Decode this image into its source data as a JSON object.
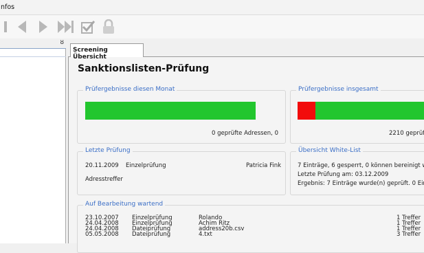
{
  "menu": {
    "label": "nfos"
  },
  "toolbar": {
    "icons": [
      "first-icon",
      "previous-icon",
      "next-icon",
      "last-icon",
      "check-icon",
      "lock-icon"
    ]
  },
  "left_panel": {
    "pin": "ȣ"
  },
  "tab": {
    "label": "Screening Übersicht"
  },
  "title": "Sanktionslisten-Prüfung",
  "month": {
    "title": "Prüfergebnisse diesen Monat",
    "caption": "0 geprüfte Adressen, 0",
    "green_fraction": 1.0
  },
  "total": {
    "title": "Prüfergebnisse insgesamt",
    "caption": "2210 geprüf"
  },
  "last_check": {
    "title": "Letzte Prüfung",
    "date": "20.11.2009",
    "type": "Einzelprüfung",
    "user": "Patricia Fink",
    "result": "Adresstreffer"
  },
  "whitelist": {
    "title": "Übersicht White-List",
    "line1": "7 Einträge, 6 gesperrt, 0 können bereinigt wer",
    "line2": "Letzte Prüfung am: 03.12.2009",
    "line3": "Ergebnis: 7 Einträge wurde(n) geprüft. 0 Eintrá"
  },
  "pending": {
    "title": "Auf Bearbeitung wartend",
    "rows": [
      {
        "date": "23.10.2007",
        "type": "Einzelprüfung",
        "name": "Rolando",
        "hits": "1 Treffer"
      },
      {
        "date": "24.04.2008",
        "type": "Einzelprüfung",
        "name": "Achim Ritz",
        "hits": "1 Treffer"
      },
      {
        "date": "24.04.2008",
        "type": "Dateiprüfung",
        "name": "address20b.csv",
        "hits": "1 Treffer"
      },
      {
        "date": "05.05.2008",
        "type": "Dateiprüfung",
        "name": "4.txt",
        "hits": "3 Treffer"
      }
    ]
  },
  "colors": {
    "accent": "#3a6ec6",
    "bar_green": "#22c62e",
    "bar_red": "#f20c0c"
  }
}
